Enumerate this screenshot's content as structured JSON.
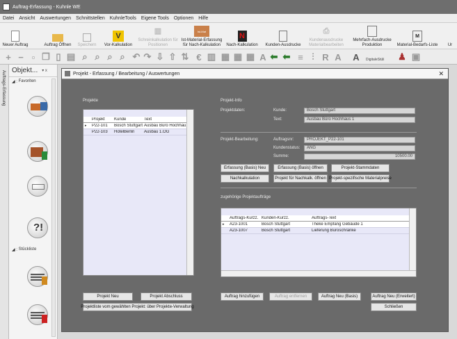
{
  "window": {
    "title": "Auftrag-Erfassung - Kuhnle WE"
  },
  "menu": [
    "Datei",
    "Ansicht",
    "Auswertungen",
    "Schnittstellen",
    "KuhnleTools",
    "Eigene Tools",
    "Optionen",
    "Hilfe"
  ],
  "toolbar": {
    "new_order": "Neuer Auftrag",
    "open_order": "Auftrag Öffnen",
    "save": "Speichern",
    "precalc": "Vor-Kalkulation",
    "labor_calc": "Schreinkalkulation für Positionen",
    "actual_material": "Ist-Material-Erfassung für Nach-Kalkulation",
    "actual_material_badge": "Ist-Mat",
    "postcalc": "Nach-Kalkulation",
    "customer_printouts": "Kunden-Ausdrucke",
    "supplier_printouts": "Kundenausdrucke Materialbearbeiten",
    "multi_printouts": "Mehrfach-Ausdrucke Produktion",
    "material_list": "Material-Bedarfs-Liste",
    "more": "Ur",
    "digital_label": "DigitaleStüli",
    "badge_m": "M"
  },
  "sidepanel": {
    "title": "Objekt...",
    "pin": "▾ x",
    "favorites": "Favoriten",
    "bom_group": "Stückliste",
    "vtab": "Auftrags-Erfassung"
  },
  "dialog": {
    "title": "Projekt - Erfassung / Bearbeitung / Auswertungen",
    "projects_label": "Projekte",
    "project_info_label": "Projekt-Info",
    "project_data_label": "Projektdaten:",
    "customer_label": "Kunde:",
    "customer_value": "Bosch Stuttgart",
    "text_label": "Text:",
    "text_value": "Ausbau Büro Hochhaus 1",
    "project_edit_label": "Projekt-Bearbeitung:",
    "order_no_label": "Auftragsnr:",
    "order_no_value": "PROJEKT_P22-101",
    "customer_status_label": "Kundenstatus:",
    "customer_status_value": "ANG",
    "sum_label": "Summe:",
    "sum_value": "10500.00",
    "related_orders_label": "zugehörige Projektaufträge",
    "projects_grid": {
      "headers": [
        "Projekt",
        "Kunde",
        "Text"
      ],
      "rows": [
        {
          "project": "P22-101",
          "customer": "Bosch Stuttgart",
          "text": "Ausbau Büro Hochhau..."
        },
        {
          "project": "P22-103",
          "customer": "HotelBerlin",
          "text": "Ausbau 1.OG"
        }
      ]
    },
    "orders_grid": {
      "headers": [
        "Auftrags-Kurzz.",
        "Kunden-Kurzz.",
        "Auftrags-Text"
      ],
      "rows": [
        {
          "order": "A23-1001",
          "customer": "Bosch Stuttgart",
          "text": "Theke Empfang Gebäude 1"
        },
        {
          "order": "A23-1007",
          "customer": "Bosch Stuttgart",
          "text": "Lieferung Büroschränke"
        }
      ]
    },
    "buttons": {
      "basis_new": "Erfassung (Basis) Neu",
      "basis_open": "Erfassung (Basis) öffnen",
      "master_data": "Projekt-Stammdaten",
      "postcalc": "Nachkalkulation",
      "project_postcalc": "Projekt für Nachkalk. öffnen",
      "material_prices": "Projekt-spezifische Materialpreise",
      "project_new": "Projekt Neu",
      "project_close": "Projekt Abschluss",
      "project_list": "Projektliste vom gewählten Projekt: über Projekte-Verwaltung",
      "order_add": "Auftrag hinzufügen",
      "order_remove": "Auftrag entfernen",
      "order_new_basis": "Auftrag Neu (Basis)",
      "order_new_ext": "Auftrag Neu (Erweitert)",
      "close": "Schließen"
    }
  }
}
